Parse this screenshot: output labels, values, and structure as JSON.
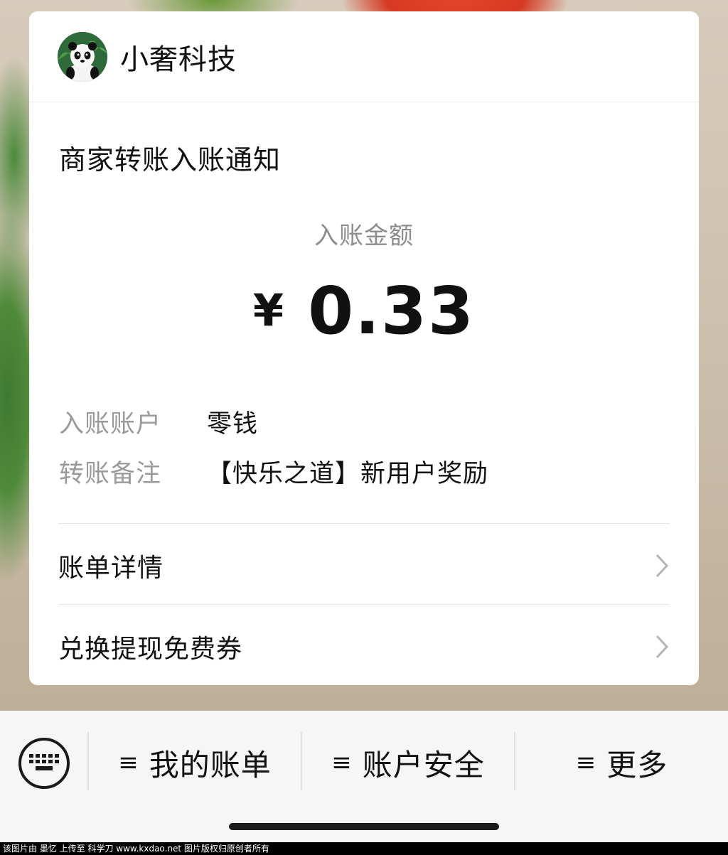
{
  "merchant": {
    "name": "小奢科技"
  },
  "notice": {
    "title": "商家转账入账通知",
    "amount_label": "入账金额",
    "currency_symbol": "¥",
    "amount": "0.33"
  },
  "details": [
    {
      "label": "入账账户",
      "value": "零钱"
    },
    {
      "label": "转账备注",
      "value": "【快乐之道】新用户奖励"
    }
  ],
  "links": [
    {
      "label": "账单详情",
      "icon": "chevron-right-icon"
    },
    {
      "label": "兑换提现免费券",
      "icon": "chevron-right-icon"
    }
  ],
  "menu": {
    "keyboard_icon": "keyboard-icon",
    "items": [
      {
        "icon": "≡",
        "label": "我的账单"
      },
      {
        "icon": "≡",
        "label": "账户安全"
      },
      {
        "icon": "≡",
        "label": "更多"
      }
    ]
  },
  "watermark": "该图片由 墨忆 上传至 科学刀 www.kxdao.net 图片版权归原创者所有",
  "colors": {
    "card_bg": "#ffffff",
    "label_gray": "#9a9a9a",
    "text_dark": "#111111",
    "menu_bg": "#f6f6f6"
  }
}
